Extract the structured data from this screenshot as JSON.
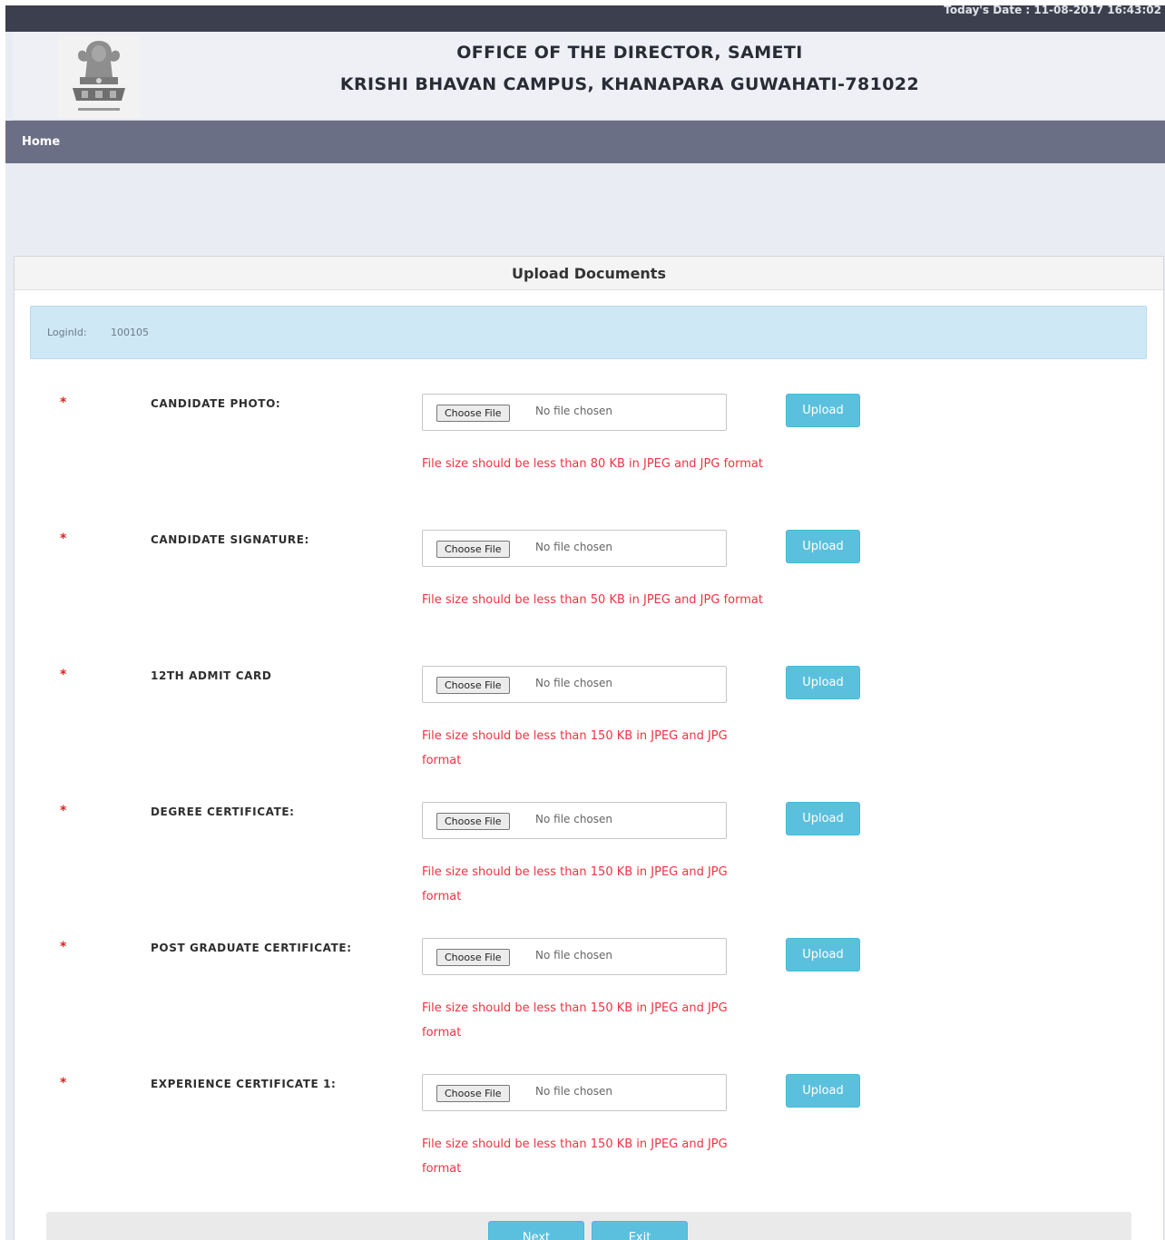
{
  "header": {
    "date_text": "Today's Date : 11-08-2017 16:43:02",
    "office_line1": "OFFICE OF THE DIRECTOR, SAMETI",
    "office_line2": "KRISHI BHAVAN CAMPUS, KHANAPARA GUWAHATI-781022",
    "emblem_icon": "national-emblem-icon"
  },
  "nav": {
    "home": "Home"
  },
  "panel": {
    "title": "Upload Documents",
    "login_label": "LoginId:",
    "login_value": "100105"
  },
  "documents": [
    {
      "required": "*",
      "label": "CANDIDATE PHOTO:",
      "choose": "Choose File",
      "no_file": "No file chosen",
      "upload": "Upload",
      "hint": "File size should be less than 80 KB in JPEG and JPG format"
    },
    {
      "required": "*",
      "label": "CANDIDATE SIGNATURE:",
      "choose": "Choose File",
      "no_file": "No file chosen",
      "upload": "Upload",
      "hint": "File size should be less than 50 KB in JPEG and JPG format"
    },
    {
      "required": "*",
      "label": "12TH ADMIT CARD",
      "choose": "Choose File",
      "no_file": "No file chosen",
      "upload": "Upload",
      "hint": "File size should be less than 150 KB in JPEG and JPG format"
    },
    {
      "required": "*",
      "label": "DEGREE CERTIFICATE:",
      "choose": "Choose File",
      "no_file": "No file chosen",
      "upload": "Upload",
      "hint": "File size should be less than 150 KB in JPEG and JPG format"
    },
    {
      "required": "*",
      "label": "POST GRADUATE CERTIFICATE:",
      "choose": "Choose File",
      "no_file": "No file chosen",
      "upload": "Upload",
      "hint": "File size should be less than 150 KB in JPEG and JPG format"
    },
    {
      "required": "*",
      "label": "EXPERIENCE CERTIFICATE 1:",
      "choose": "Choose File",
      "no_file": "No file chosen",
      "upload": "Upload",
      "hint": "File size should be less than 150 KB in JPEG and JPG format"
    }
  ],
  "footer": {
    "next": "Next",
    "exit": "Exit"
  },
  "colors": {
    "topbar": "#3c3f4e",
    "navbar": "#6b6f85",
    "page_bg": "#e9ecf3",
    "info_box": "#cfe8f5",
    "button": "#5bc0de",
    "hint_text": "#ef3340",
    "required_mark": "#e02020"
  }
}
